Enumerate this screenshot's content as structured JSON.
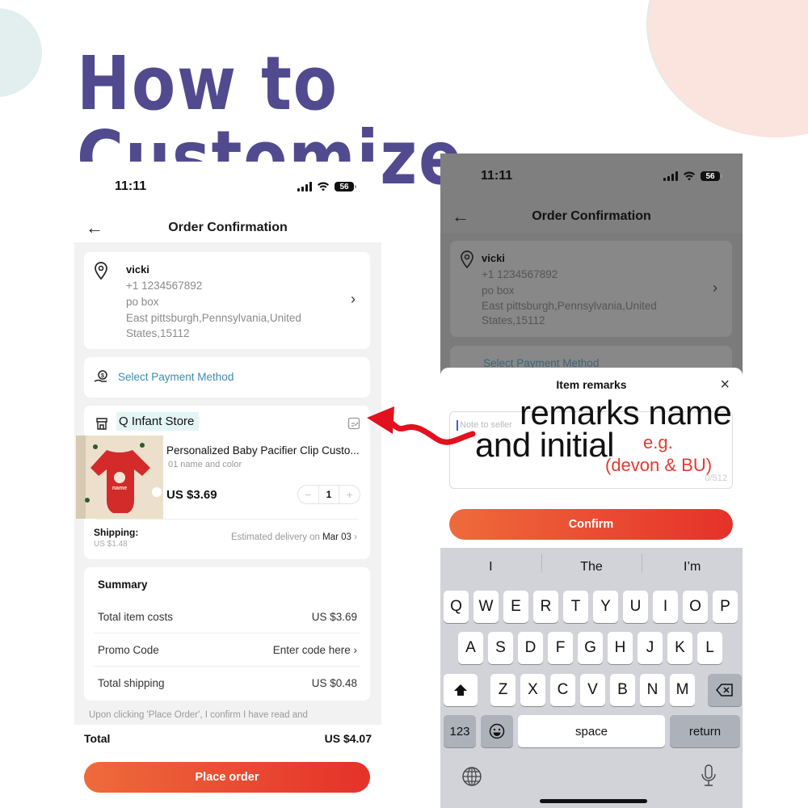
{
  "headline": "How to Customize",
  "colors": {
    "headline": "#524a8f",
    "accent_gradient_start": "#ee6b3b",
    "accent_gradient_end": "#e5312a",
    "link": "#3c8cad",
    "annotation_red": "#e33a2f"
  },
  "left_phone": {
    "status": {
      "time": "11:11",
      "battery": "56"
    },
    "nav": {
      "back_icon": "arrow-left-icon",
      "title": "Order Confirmation"
    },
    "address": {
      "icon": "location-pin-icon",
      "name": "vicki",
      "phone": "+1 1234567892",
      "line1": "po box",
      "line2": "East pittsburgh,Pennsylvania,United",
      "line3": "States,15112",
      "chevron": "›"
    },
    "payment": {
      "icon": "payment-hand-icon",
      "label": "Select Payment Method"
    },
    "store": {
      "icon": "store-icon",
      "name": "Q Infant Store",
      "edit_icon": "edit-note-icon",
      "product": {
        "title": "Personalized Baby Pacifier Clip Custo...",
        "variant": "01 name and color",
        "price": "US $3.69",
        "quantity": "1",
        "minus": "−",
        "plus": "+"
      },
      "shipping_label": "Shipping:",
      "shipping_price": "US $1.48",
      "delivery_prefix": "Estimated delivery on",
      "delivery_date": "Mar 03",
      "delivery_chevron": "›"
    },
    "summary": {
      "title": "Summary",
      "rows": [
        {
          "label": "Total item costs",
          "value": "US $3.69"
        },
        {
          "label": "Promo Code",
          "value": "Enter code here ›"
        },
        {
          "label": "Total shipping",
          "value": "US $0.48"
        }
      ]
    },
    "legal": "Upon clicking 'Place Order', I confirm I have read and",
    "total_label": "Total",
    "total_value": "US $4.07",
    "place_order": "Place order"
  },
  "right_phone": {
    "status": {
      "time": "11:11",
      "battery": "56"
    },
    "nav": {
      "title": "Order Confirmation"
    },
    "address": {
      "name": "vicki",
      "phone": "+1 1234567892",
      "line1": "po box",
      "line2": "East pittsburgh,Pennsylvania,United",
      "line3": "States,15112",
      "chevron": "›"
    },
    "payment_label": "Select Payment Method",
    "sheet": {
      "title": "Item remarks",
      "close": "×",
      "placeholder": "Note to seller",
      "count": "0/512",
      "confirm": "Confirm"
    },
    "keyboard": {
      "suggestions": [
        "I",
        "The",
        "I’m"
      ],
      "row1": [
        "Q",
        "W",
        "E",
        "R",
        "T",
        "Y",
        "U",
        "I",
        "O",
        "P"
      ],
      "row2": [
        "A",
        "S",
        "D",
        "F",
        "G",
        "H",
        "J",
        "K",
        "L"
      ],
      "row3": [
        "Z",
        "X",
        "C",
        "V",
        "B",
        "N",
        "M"
      ],
      "numbers": "123",
      "space": "space",
      "return": "return"
    }
  },
  "annotation": {
    "line1": "remarks name",
    "line2": "and initial",
    "eg": "e.g.",
    "example": "(devon & BU)"
  }
}
